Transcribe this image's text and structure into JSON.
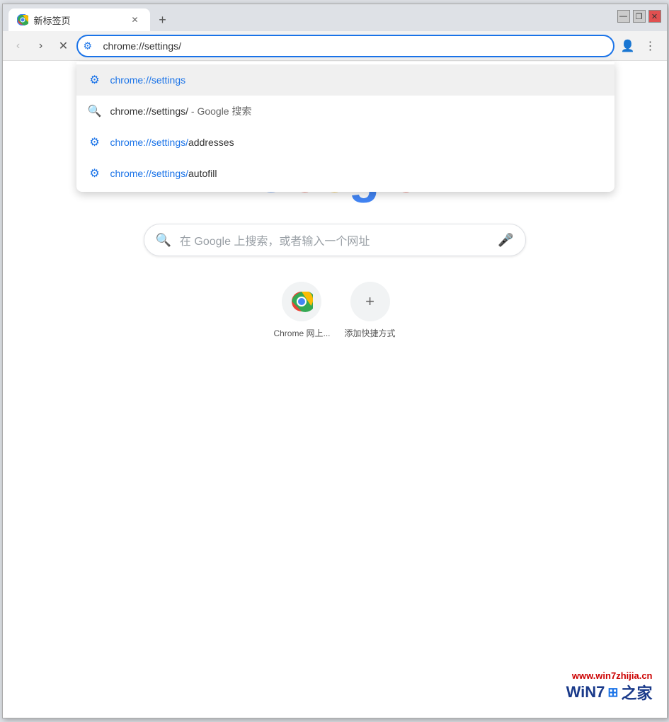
{
  "window": {
    "title": "新标签页",
    "controls": {
      "minimize": "—",
      "restore": "❐",
      "close": "✕"
    }
  },
  "tab": {
    "title": "新标签页",
    "close_label": "✕",
    "new_tab_label": "+"
  },
  "toolbar": {
    "back_label": "‹",
    "forward_label": "›",
    "close_label": "✕",
    "address_value": "chrome://settings/",
    "profile_icon": "👤",
    "menu_icon": "⋮"
  },
  "autocomplete": {
    "items": [
      {
        "type": "settings",
        "text_before": "chrome://settings",
        "text_after": ""
      },
      {
        "type": "search",
        "text_before": "chrome://settings/",
        "text_middle": "",
        "text_after": " - Google 搜索"
      },
      {
        "type": "settings",
        "text_before": "chrome://settings/",
        "text_after": "addresses"
      },
      {
        "type": "settings",
        "text_before": "chrome://settings/",
        "text_after": "autofill"
      }
    ]
  },
  "newtab": {
    "google_logo": {
      "G": "G",
      "o1": "o",
      "o2": "o",
      "g": "g",
      "l": "l",
      "e": "e"
    },
    "search_placeholder": "在 Google 上搜索，或者输入一个网址",
    "shortcuts": [
      {
        "label": "Chrome 网上...",
        "type": "chrome"
      },
      {
        "label": "添加快捷方式",
        "type": "add"
      }
    ]
  },
  "watermark": {
    "url": "www.win7zhijia.cn",
    "logo_text": "WiN7",
    "logo_suffix": "之家"
  }
}
